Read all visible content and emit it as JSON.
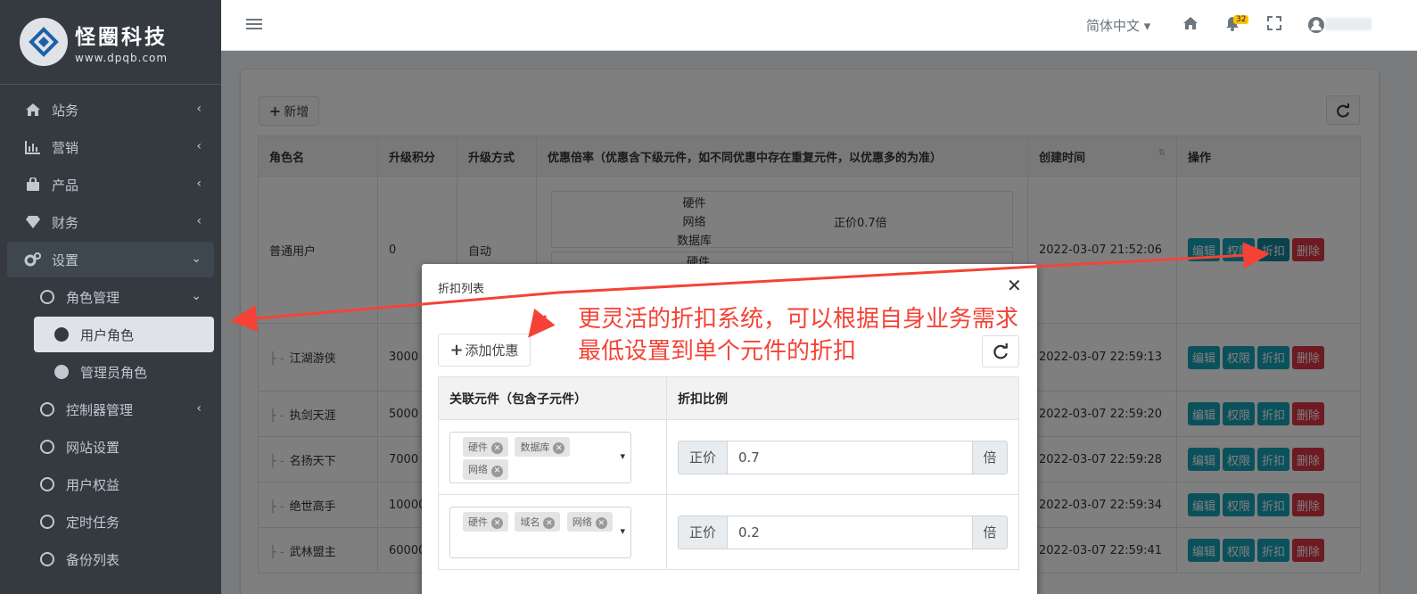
{
  "brand": {
    "name": "怪圈科技",
    "url": "www.dpqb.com"
  },
  "sidebar": {
    "items": [
      {
        "label": "站务"
      },
      {
        "label": "营销"
      },
      {
        "label": "产品"
      },
      {
        "label": "财务"
      },
      {
        "label": "设置"
      }
    ],
    "sub": [
      {
        "label": "角色管理"
      },
      {
        "label": "用户角色"
      },
      {
        "label": "管理员角色"
      },
      {
        "label": "控制器管理"
      },
      {
        "label": "网站设置"
      },
      {
        "label": "用户权益"
      },
      {
        "label": "定时任务"
      },
      {
        "label": "备份列表"
      }
    ]
  },
  "topbar": {
    "lang": "简体中文",
    "notif_count": "32"
  },
  "toolbar": {
    "add_label": "新增"
  },
  "table": {
    "headers": [
      "角色名",
      "升级积分",
      "升级方式",
      "优惠倍率（优惠含下级元件，如不同优惠中存在重复元件，以优惠多的为准）",
      "创建时间",
      "操作"
    ],
    "rows": [
      {
        "name": "普通用户",
        "points": "0",
        "method": "自动",
        "time": "2022-03-07 21:52:06"
      },
      {
        "name": "江湖游侠",
        "points": "3000",
        "time": "2022-03-07 22:59:13"
      },
      {
        "name": "执剑天涯",
        "points": "5000",
        "time": "2022-03-07 22:59:20"
      },
      {
        "name": "名扬天下",
        "points": "7000",
        "time": "2022-03-07 22:59:28"
      },
      {
        "name": "绝世高手",
        "points": "10000",
        "time": "2022-03-07 22:59:34"
      },
      {
        "name": "武林盟主",
        "points": "60000",
        "time": "2022-03-07 22:59:41"
      }
    ],
    "discount": {
      "items": [
        "硬件",
        "网络",
        "数据库"
      ],
      "value": "正价0.7倍",
      "second_first": "硬件"
    },
    "ops": {
      "edit": "编辑",
      "perm": "权限",
      "discount": "折扣",
      "delete": "删除"
    }
  },
  "modal": {
    "title": "折扣列表",
    "add_label": "添加优惠",
    "headers": [
      "关联元件（包含子元件）",
      "折扣比例"
    ],
    "rows": [
      {
        "tags": [
          "硬件",
          "数据库",
          "网络"
        ],
        "prefix": "正价",
        "value": "0.7",
        "suffix": "倍"
      },
      {
        "tags": [
          "硬件",
          "域名",
          "网络"
        ],
        "prefix": "正价",
        "value": "0.2",
        "suffix": "倍"
      }
    ]
  },
  "annotation": {
    "line1": "更灵活的折扣系统，可以根据自身业务需求",
    "line2": "最低设置到单个元件的折扣"
  },
  "colors": {
    "sidebar": "#343a40",
    "info": "#17a2b8",
    "danger": "#dc3545",
    "annotation": "#f44336"
  }
}
